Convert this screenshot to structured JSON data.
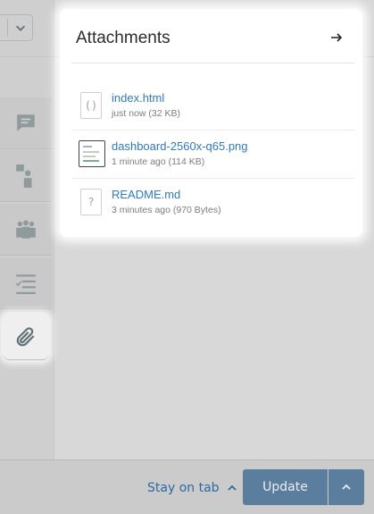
{
  "popover": {
    "title": "Attachments",
    "attachments": [
      {
        "name": "index.html",
        "meta": "just now (32 KB)",
        "icon": "code-file-icon",
        "thumb_glyph": "()"
      },
      {
        "name": "dashboard-2560x-q65.png",
        "meta": "1 minute ago (114 KB)",
        "icon": "image-thumbnail-icon"
      },
      {
        "name": "README.md",
        "meta": "3 minutes ago (970 Bytes)",
        "icon": "unknown-file-icon",
        "thumb_glyph": "?"
      }
    ]
  },
  "bottom_bar": {
    "stay_on_tab_label": "Stay on tab",
    "update_label": "Update"
  },
  "colors": {
    "link": "#2f7bbf",
    "primary_button": "#5b7e9f",
    "muted_text": "#7d7d7d"
  },
  "rail_icons": [
    "chat-icon",
    "customer-icon",
    "organization-icon",
    "checklist-icon",
    "paperclip-icon"
  ]
}
